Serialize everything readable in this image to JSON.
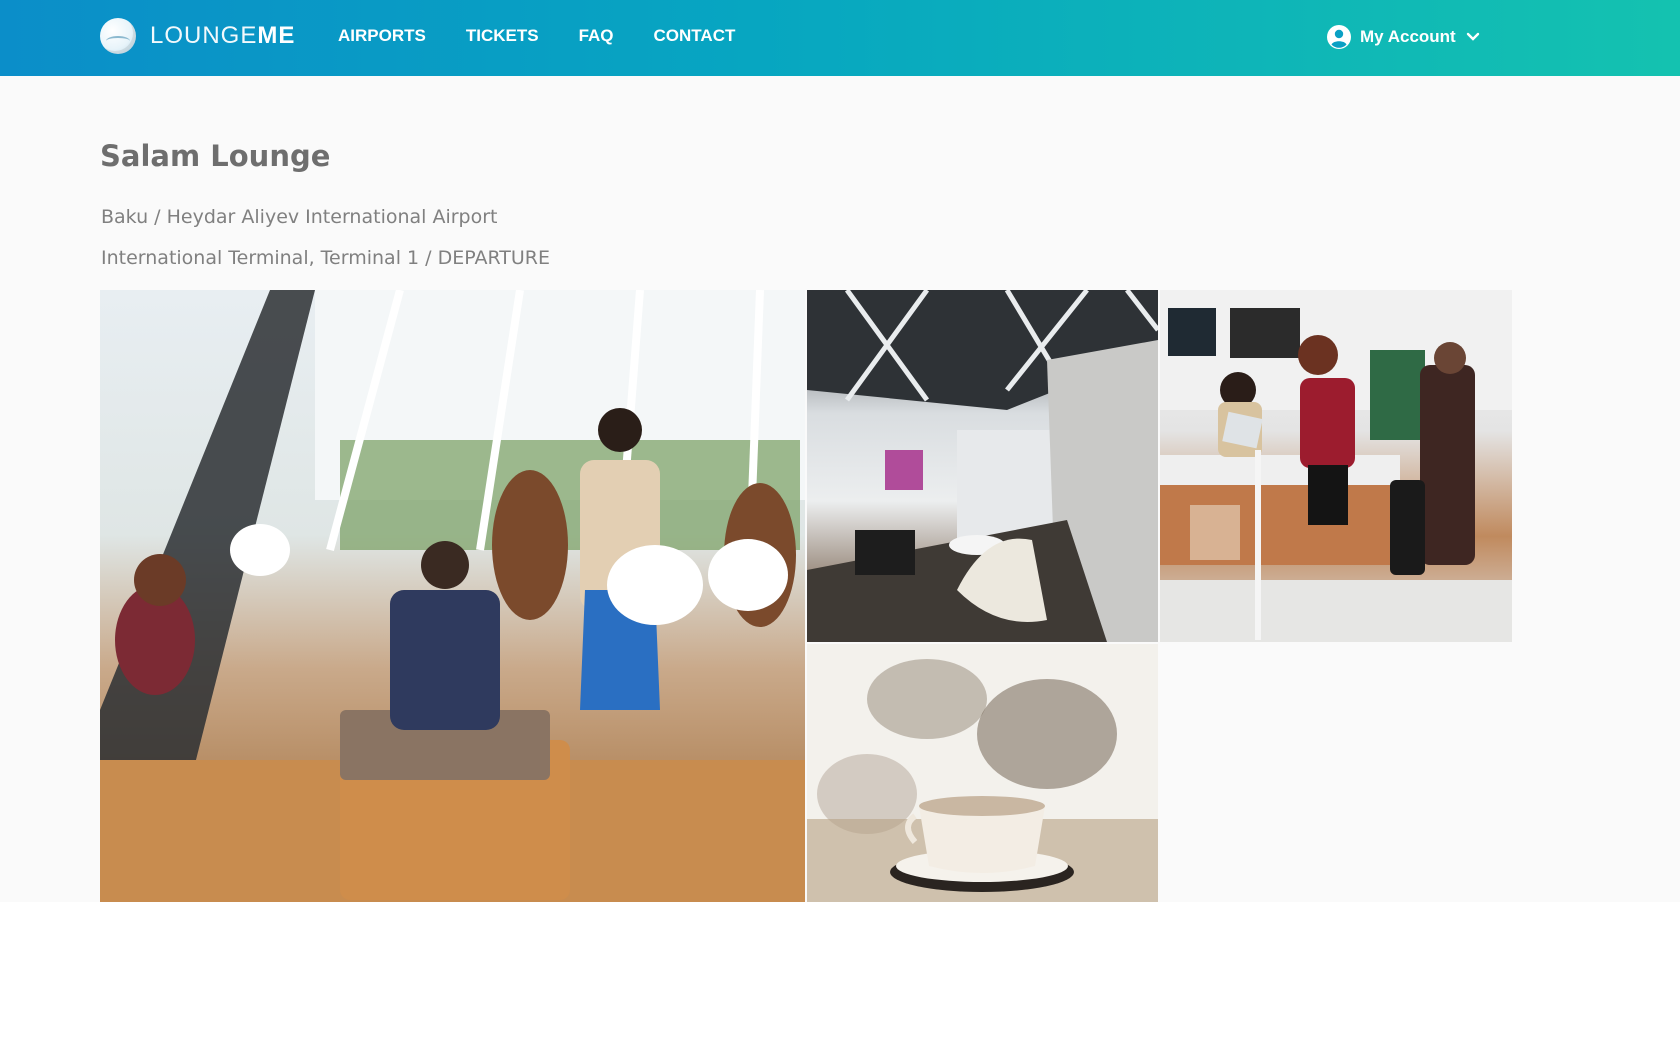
{
  "brand": {
    "name_light": "LOUNGE",
    "name_bold": "ME"
  },
  "nav": {
    "items": [
      {
        "label": "AIRPORTS"
      },
      {
        "label": "TICKETS"
      },
      {
        "label": "FAQ"
      },
      {
        "label": "CONTACT"
      }
    ]
  },
  "account": {
    "label": "My Account",
    "icon": "user-circle-icon",
    "chevron": "chevron-down-icon"
  },
  "lounge": {
    "title": "Salam Lounge",
    "location": "Baku / Heydar Aliyev International Airport",
    "terminal": "International Terminal, Terminal 1 / DEPARTURE"
  },
  "gallery": {
    "images": [
      {
        "alt": "Lounge seating area with guests and hostess"
      },
      {
        "alt": "Lounge interior with computer desk"
      },
      {
        "alt": "Reception desk check-in"
      },
      {
        "alt": "Coffee cup on table"
      }
    ]
  },
  "colors": {
    "header_start": "#0b8ec9",
    "header_end": "#14c2b0",
    "title": "#6e6e6e",
    "subtext": "#808080"
  }
}
